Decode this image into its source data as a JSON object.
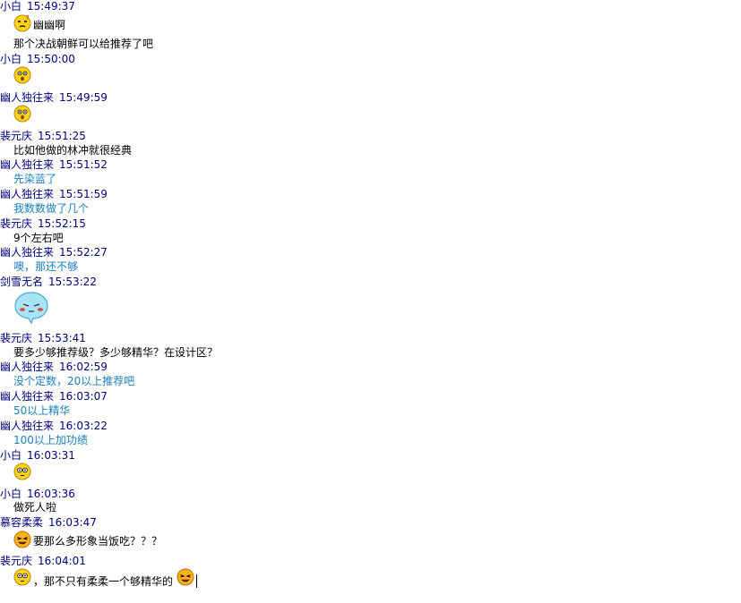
{
  "messages": [
    {
      "sender": "小白",
      "time": "15:49:37",
      "kind": "emoticon_text",
      "icon": "dizzy-face-icon",
      "text": "幽幽啊"
    },
    {
      "kind": "text",
      "color": "black",
      "text": "那个决战朝鲜可以给推荐了吧"
    },
    {
      "sender": "小白",
      "time": "15:50:00",
      "kind": "emoticon",
      "icon": "surprised-face-icon"
    },
    {
      "sender": "幽人独往来",
      "time": "15:49:59",
      "kind": "emoticon",
      "icon": "surprised-face-icon"
    },
    {
      "sender": "裴元庆",
      "time": "15:51:25",
      "kind": "text",
      "color": "black",
      "text": "比如他做的林冲就很经典"
    },
    {
      "sender": "幽人独往来",
      "time": "15:51:52",
      "kind": "text",
      "color": "blue",
      "text": "先染蓝了"
    },
    {
      "sender": "幽人独往来",
      "time": "15:51:59",
      "kind": "text",
      "color": "blue",
      "text": "我数数做了几个"
    },
    {
      "sender": "裴元庆",
      "time": "15:52:15",
      "kind": "text",
      "color": "black",
      "text": "9个左右吧"
    },
    {
      "sender": "幽人独往来",
      "time": "15:52:27",
      "kind": "text",
      "color": "blue",
      "text": "噢，那还不够"
    },
    {
      "sender": "剑雪无名",
      "time": "15:53:22",
      "kind": "emoticon",
      "icon": "blushing-bubble-icon"
    },
    {
      "sender": "裴元庆",
      "time": "15:53:41",
      "kind": "text",
      "color": "black",
      "text": "要多少够推荐级？多少够精华？在设计区？"
    },
    {
      "sender": "幽人独往来",
      "time": "16:02:59",
      "kind": "text",
      "color": "blue",
      "text": "没个定数，20以上推荐吧"
    },
    {
      "sender": "幽人独往来",
      "time": "16:03:07",
      "kind": "text",
      "color": "blue",
      "text": "50以上精华"
    },
    {
      "sender": "幽人独往来",
      "time": "16:03:22",
      "kind": "text",
      "color": "blue",
      "text": "100以上加功绩"
    },
    {
      "sender": "小白",
      "time": "16:03:31",
      "kind": "emoticon",
      "icon": "wide-eyed-face-icon"
    },
    {
      "sender": "小白",
      "time": "16:03:36",
      "kind": "text",
      "color": "black",
      "text": "做死人啦"
    },
    {
      "sender": "慕容柔柔",
      "time": "16:03:47",
      "kind": "emoticon_text",
      "icon": "squinting-grin-icon",
      "text": "要那么多形象当饭吃？？？"
    },
    {
      "sender": "裴元庆",
      "time": "16:04:01",
      "kind": "emoticon_text_emoticon",
      "icon": "wide-eyed-face-icon",
      "text": "，那不只有柔柔一个够精华的",
      "icon2": "squinting-grin-icon"
    }
  ],
  "colors": {
    "header": "#000080",
    "message_black": "#000000",
    "message_blue": "#1a7fc0",
    "emoticon_yellow": "#ffd21a"
  }
}
